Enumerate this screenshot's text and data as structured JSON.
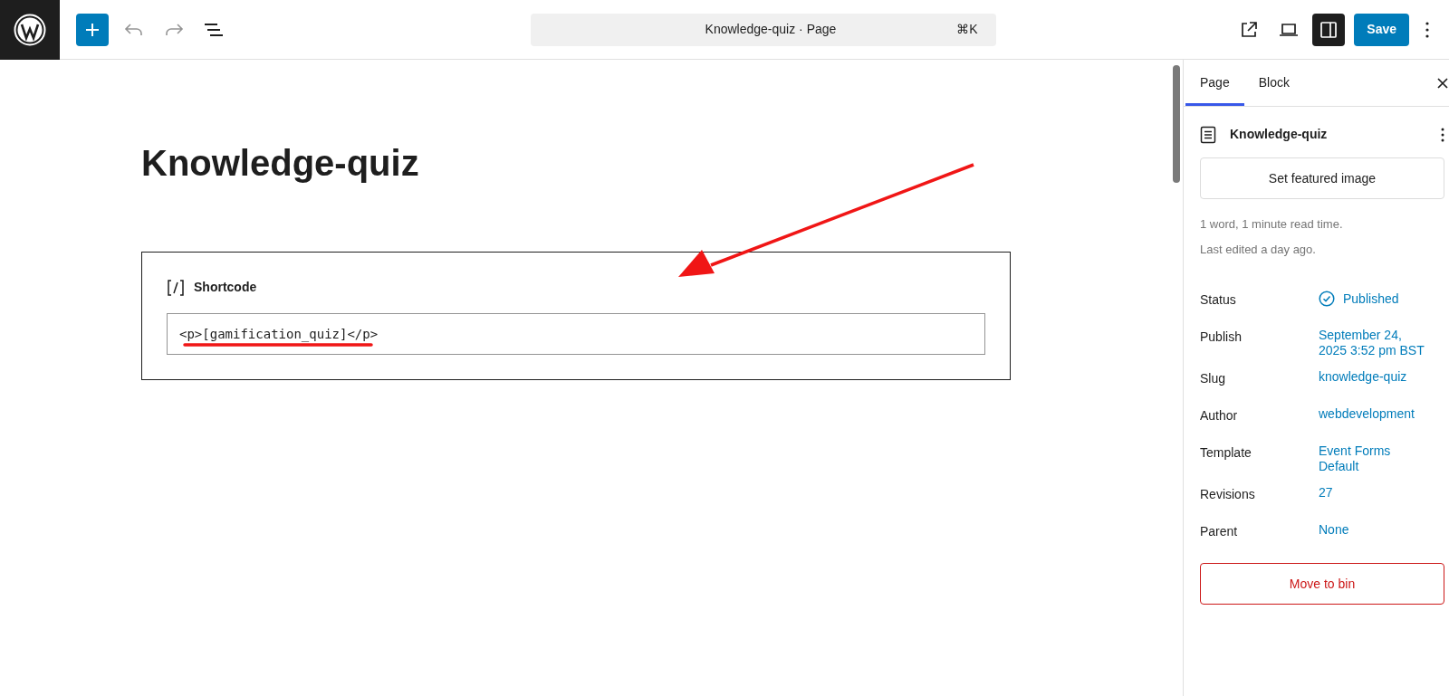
{
  "toolbar": {
    "document_title": "Knowledge-quiz · Page",
    "shortcut": "⌘K",
    "save_label": "Save",
    "settings_panel_open": true
  },
  "editor": {
    "title": "Knowledge-quiz",
    "block": {
      "label": "Shortcode",
      "code": "<p>[gamification_quiz]</p>"
    }
  },
  "sidebar": {
    "tabs": [
      {
        "label": "Page",
        "selected": true
      },
      {
        "label": "Block",
        "selected": false
      }
    ],
    "page_title": "Knowledge-quiz",
    "featured_image_button": "Set featured image",
    "info": [
      "1 word, 1 minute read time.",
      "Last edited a day ago."
    ],
    "fields": [
      {
        "label": "Status",
        "kind": "status",
        "lines": [
          "Published"
        ]
      },
      {
        "label": "Publish",
        "kind": "link",
        "lines": [
          "September 24,",
          "2025 3:52 pm BST"
        ]
      },
      {
        "label": "Slug",
        "kind": "link",
        "lines": [
          "knowledge-quiz"
        ]
      },
      {
        "label": "Author",
        "kind": "link",
        "lines": [
          "webdevelopment"
        ]
      },
      {
        "label": "Template",
        "kind": "link",
        "lines": [
          "Event Forms",
          "Default"
        ]
      },
      {
        "label": "Revisions",
        "kind": "link",
        "lines": [
          "27"
        ]
      },
      {
        "label": "Parent",
        "kind": "link",
        "lines": [
          "None"
        ]
      }
    ],
    "bin_button": "Move to bin"
  }
}
